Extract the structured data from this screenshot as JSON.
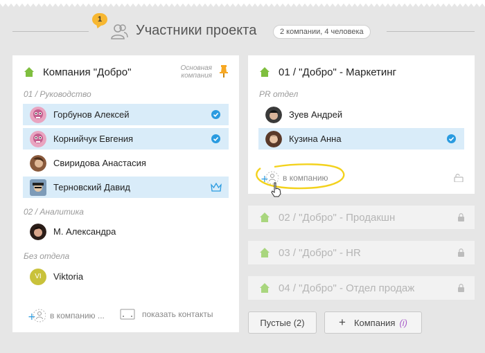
{
  "header": {
    "notification_count": "1",
    "title": "Участники проекта",
    "summary": "2 компании, 4 человека"
  },
  "left_company": {
    "name": "Компания \"Добро\"",
    "main_note_line1": "Основная",
    "main_note_line2": "компания",
    "departments": [
      {
        "label": "01 / Руководство",
        "members": [
          {
            "name": "Горбунов Алексей",
            "selected": true,
            "badge": "check"
          },
          {
            "name": "Корнийчук Евгения",
            "selected": true,
            "badge": "check"
          },
          {
            "name": "Свиридова Анастасия",
            "selected": false,
            "badge": ""
          },
          {
            "name": "Терновский Давид",
            "selected": true,
            "badge": "crown"
          }
        ]
      },
      {
        "label": "02 / Аналитика",
        "members": [
          {
            "name": "М. Александра",
            "selected": false,
            "badge": ""
          }
        ]
      },
      {
        "label": "Без отдела",
        "members": [
          {
            "name": "Viktoria",
            "selected": false,
            "badge": "",
            "initials": "VI"
          }
        ]
      }
    ],
    "add_to_company_label": "в компанию ...",
    "show_contacts_label": "показать контакты"
  },
  "right_company": {
    "name": "01 / \"Добро\" - Маркетинг",
    "department": "PR отдел",
    "members": [
      {
        "name": "Зуев Андрей",
        "selected": false,
        "badge": ""
      },
      {
        "name": "Кузина Анна",
        "selected": true,
        "badge": "check"
      }
    ],
    "add_to_company_label": "в компанию"
  },
  "collapsed_companies": [
    {
      "name": "02 / \"Добро\" - Продакшн"
    },
    {
      "name": "03 / \"Добро\" - HR"
    },
    {
      "name": "04 / \"Добро\" - Отдел продаж"
    }
  ],
  "buttons": {
    "empty_label": "Пустые (2)",
    "add_company_label": "Компания",
    "add_company_info": "(i)"
  },
  "colors": {
    "accent_green": "#7fbf3f",
    "selection_blue": "#d9ecf9",
    "check_blue": "#2a9be0",
    "highlight_yellow": "#f3d21d",
    "badge_orange": "#f7b731"
  }
}
